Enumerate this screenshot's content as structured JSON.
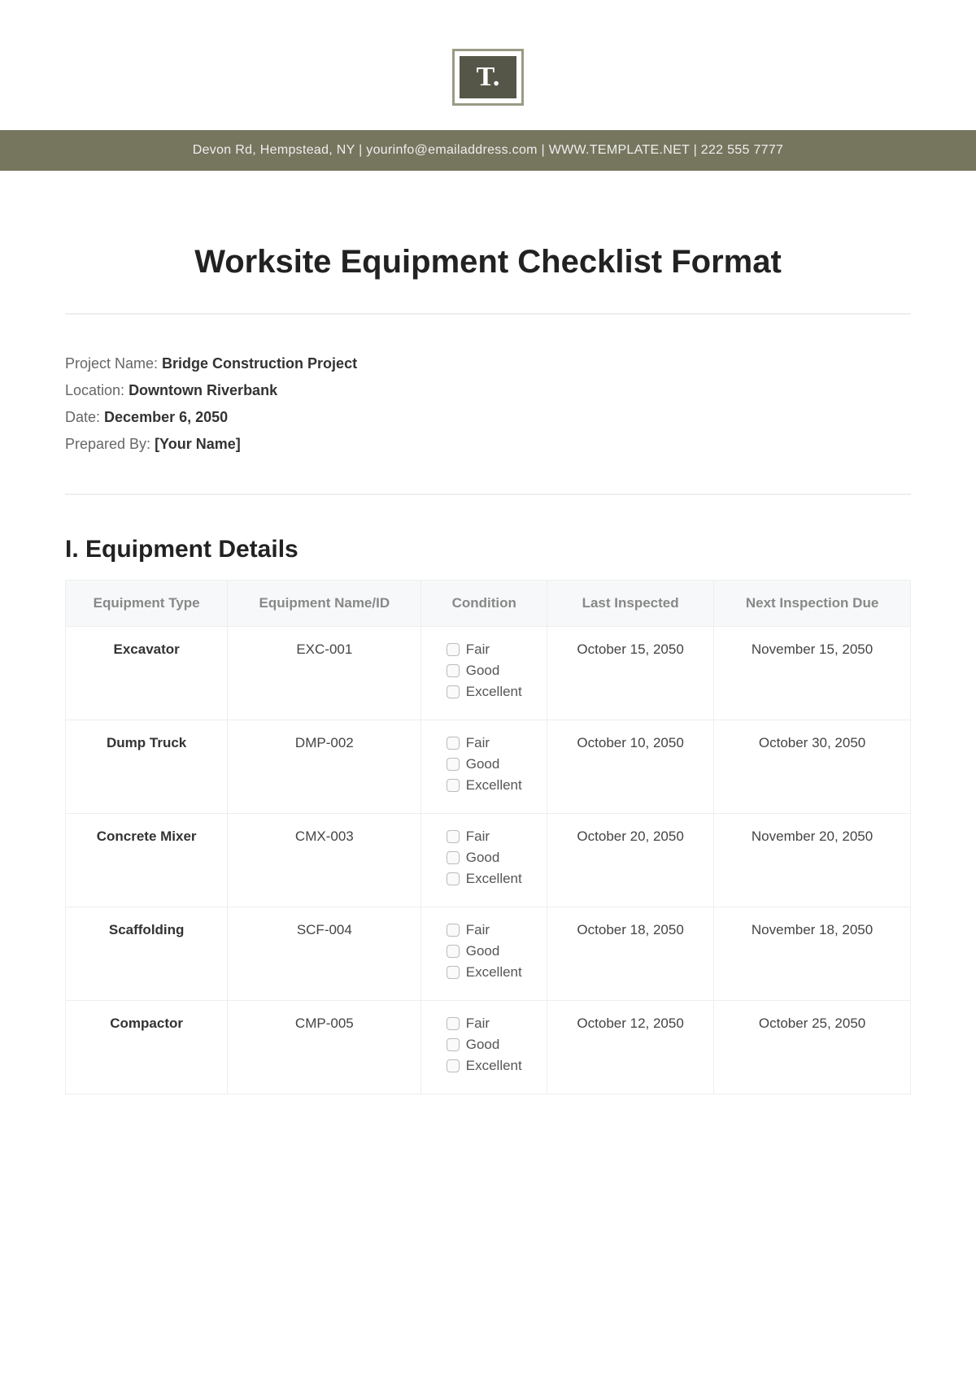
{
  "logo_text": "T.",
  "banner": "Devon Rd, Hempstead, NY | yourinfo@emailaddress.com | WWW.TEMPLATE.NET | 222 555 7777",
  "title": "Worksite Equipment Checklist Format",
  "meta": {
    "project_label": "Project Name: ",
    "project_value": "Bridge Construction Project",
    "location_label": "Location: ",
    "location_value": "Downtown Riverbank",
    "date_label": "Date: ",
    "date_value": "December 6, 2050",
    "prepared_label": "Prepared By: ",
    "prepared_value": "[Your Name]"
  },
  "section_title": "I. Equipment Details",
  "headers": {
    "type": "Equipment Type",
    "id": "Equipment Name/ID",
    "condition": "Condition",
    "last": "Last Inspected",
    "next": "Next Inspection Due"
  },
  "condition_options": [
    "Fair",
    "Good",
    "Excellent"
  ],
  "rows": [
    {
      "type": "Excavator",
      "id": "EXC-001",
      "last": "October 15, 2050",
      "next": "November 15, 2050"
    },
    {
      "type": "Dump Truck",
      "id": "DMP-002",
      "last": "October 10, 2050",
      "next": "October 30, 2050"
    },
    {
      "type": "Concrete Mixer",
      "id": "CMX-003",
      "last": "October 20, 2050",
      "next": "November 20, 2050"
    },
    {
      "type": "Scaffolding",
      "id": "SCF-004",
      "last": "October 18, 2050",
      "next": "November 18, 2050"
    },
    {
      "type": "Compactor",
      "id": "CMP-005",
      "last": "October 12, 2050",
      "next": "October 25, 2050"
    }
  ]
}
